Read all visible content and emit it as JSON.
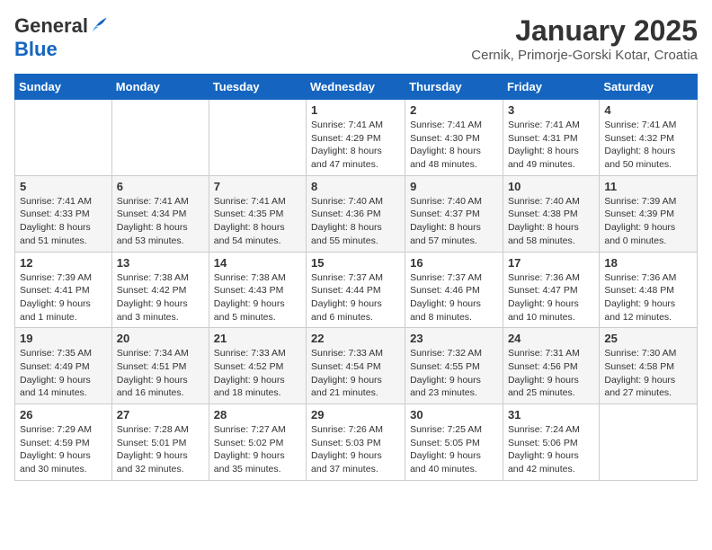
{
  "header": {
    "logo_general": "General",
    "logo_blue": "Blue",
    "month_title": "January 2025",
    "subtitle": "Cernik, Primorje-Gorski Kotar, Croatia"
  },
  "weekdays": [
    "Sunday",
    "Monday",
    "Tuesday",
    "Wednesday",
    "Thursday",
    "Friday",
    "Saturday"
  ],
  "weeks": [
    [
      {
        "day": "",
        "content": ""
      },
      {
        "day": "",
        "content": ""
      },
      {
        "day": "",
        "content": ""
      },
      {
        "day": "1",
        "content": "Sunrise: 7:41 AM\nSunset: 4:29 PM\nDaylight: 8 hours and 47 minutes."
      },
      {
        "day": "2",
        "content": "Sunrise: 7:41 AM\nSunset: 4:30 PM\nDaylight: 8 hours and 48 minutes."
      },
      {
        "day": "3",
        "content": "Sunrise: 7:41 AM\nSunset: 4:31 PM\nDaylight: 8 hours and 49 minutes."
      },
      {
        "day": "4",
        "content": "Sunrise: 7:41 AM\nSunset: 4:32 PM\nDaylight: 8 hours and 50 minutes."
      }
    ],
    [
      {
        "day": "5",
        "content": "Sunrise: 7:41 AM\nSunset: 4:33 PM\nDaylight: 8 hours and 51 minutes."
      },
      {
        "day": "6",
        "content": "Sunrise: 7:41 AM\nSunset: 4:34 PM\nDaylight: 8 hours and 53 minutes."
      },
      {
        "day": "7",
        "content": "Sunrise: 7:41 AM\nSunset: 4:35 PM\nDaylight: 8 hours and 54 minutes."
      },
      {
        "day": "8",
        "content": "Sunrise: 7:40 AM\nSunset: 4:36 PM\nDaylight: 8 hours and 55 minutes."
      },
      {
        "day": "9",
        "content": "Sunrise: 7:40 AM\nSunset: 4:37 PM\nDaylight: 8 hours and 57 minutes."
      },
      {
        "day": "10",
        "content": "Sunrise: 7:40 AM\nSunset: 4:38 PM\nDaylight: 8 hours and 58 minutes."
      },
      {
        "day": "11",
        "content": "Sunrise: 7:39 AM\nSunset: 4:39 PM\nDaylight: 9 hours and 0 minutes."
      }
    ],
    [
      {
        "day": "12",
        "content": "Sunrise: 7:39 AM\nSunset: 4:41 PM\nDaylight: 9 hours and 1 minute."
      },
      {
        "day": "13",
        "content": "Sunrise: 7:38 AM\nSunset: 4:42 PM\nDaylight: 9 hours and 3 minutes."
      },
      {
        "day": "14",
        "content": "Sunrise: 7:38 AM\nSunset: 4:43 PM\nDaylight: 9 hours and 5 minutes."
      },
      {
        "day": "15",
        "content": "Sunrise: 7:37 AM\nSunset: 4:44 PM\nDaylight: 9 hours and 6 minutes."
      },
      {
        "day": "16",
        "content": "Sunrise: 7:37 AM\nSunset: 4:46 PM\nDaylight: 9 hours and 8 minutes."
      },
      {
        "day": "17",
        "content": "Sunrise: 7:36 AM\nSunset: 4:47 PM\nDaylight: 9 hours and 10 minutes."
      },
      {
        "day": "18",
        "content": "Sunrise: 7:36 AM\nSunset: 4:48 PM\nDaylight: 9 hours and 12 minutes."
      }
    ],
    [
      {
        "day": "19",
        "content": "Sunrise: 7:35 AM\nSunset: 4:49 PM\nDaylight: 9 hours and 14 minutes."
      },
      {
        "day": "20",
        "content": "Sunrise: 7:34 AM\nSunset: 4:51 PM\nDaylight: 9 hours and 16 minutes."
      },
      {
        "day": "21",
        "content": "Sunrise: 7:33 AM\nSunset: 4:52 PM\nDaylight: 9 hours and 18 minutes."
      },
      {
        "day": "22",
        "content": "Sunrise: 7:33 AM\nSunset: 4:54 PM\nDaylight: 9 hours and 21 minutes."
      },
      {
        "day": "23",
        "content": "Sunrise: 7:32 AM\nSunset: 4:55 PM\nDaylight: 9 hours and 23 minutes."
      },
      {
        "day": "24",
        "content": "Sunrise: 7:31 AM\nSunset: 4:56 PM\nDaylight: 9 hours and 25 minutes."
      },
      {
        "day": "25",
        "content": "Sunrise: 7:30 AM\nSunset: 4:58 PM\nDaylight: 9 hours and 27 minutes."
      }
    ],
    [
      {
        "day": "26",
        "content": "Sunrise: 7:29 AM\nSunset: 4:59 PM\nDaylight: 9 hours and 30 minutes."
      },
      {
        "day": "27",
        "content": "Sunrise: 7:28 AM\nSunset: 5:01 PM\nDaylight: 9 hours and 32 minutes."
      },
      {
        "day": "28",
        "content": "Sunrise: 7:27 AM\nSunset: 5:02 PM\nDaylight: 9 hours and 35 minutes."
      },
      {
        "day": "29",
        "content": "Sunrise: 7:26 AM\nSunset: 5:03 PM\nDaylight: 9 hours and 37 minutes."
      },
      {
        "day": "30",
        "content": "Sunrise: 7:25 AM\nSunset: 5:05 PM\nDaylight: 9 hours and 40 minutes."
      },
      {
        "day": "31",
        "content": "Sunrise: 7:24 AM\nSunset: 5:06 PM\nDaylight: 9 hours and 42 minutes."
      },
      {
        "day": "",
        "content": ""
      }
    ]
  ]
}
